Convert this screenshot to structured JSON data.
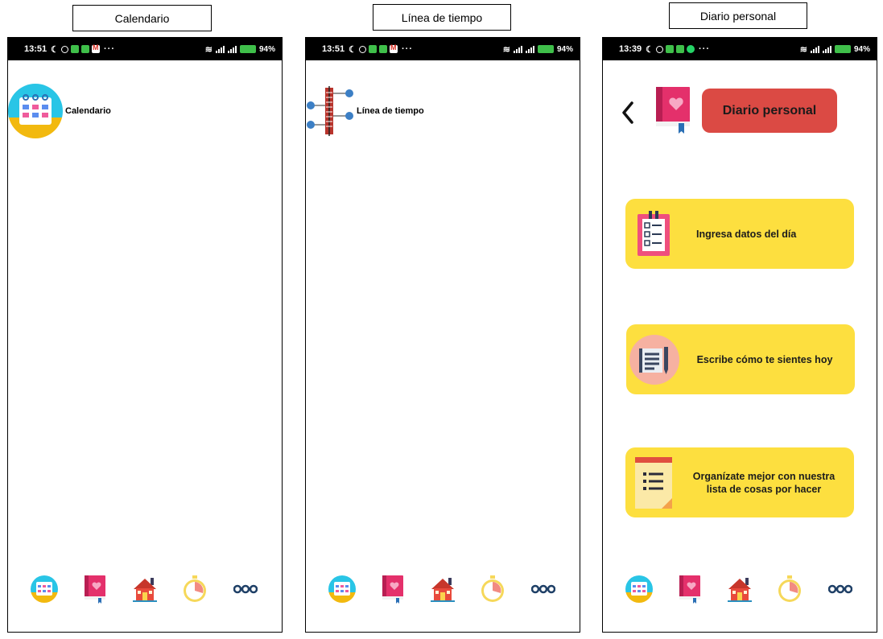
{
  "captions": [
    "Calendario",
    "Línea de tiempo",
    "Diario personal"
  ],
  "phones": [
    {
      "status": {
        "time": "13:51",
        "battery": "94"
      },
      "row_label": "Calendario"
    },
    {
      "status": {
        "time": "13:51",
        "battery": "94"
      },
      "row_label": "Línea de tiempo"
    },
    {
      "status": {
        "time": "13:39",
        "battery": "94"
      },
      "title": "Diario personal",
      "cards": [
        {
          "label": "Ingresa datos del día",
          "icon": "checklist-clipboard-icon"
        },
        {
          "label": "Escribe cómo te sientes hoy",
          "icon": "notebook-pencil-icon"
        },
        {
          "label": "Organízate mejor con nuestra lista de cosas por hacer",
          "icon": "todo-list-icon"
        }
      ]
    }
  ],
  "status_suffix": "%",
  "status_more": "···",
  "bottom_nav": [
    "calendar-icon",
    "diary-book-icon",
    "home-icon",
    "timer-icon",
    "more-icon"
  ],
  "colors": {
    "title_pill": "#db4a44",
    "card": "#fddf3f",
    "calendar_cyan": "#29c5e6",
    "calendar_yellow": "#f2b90f",
    "book_pink": "#e4306b",
    "home_red": "#e84a3c",
    "timer_yellow": "#f6d85a",
    "more_blue": "#1e3f66"
  }
}
